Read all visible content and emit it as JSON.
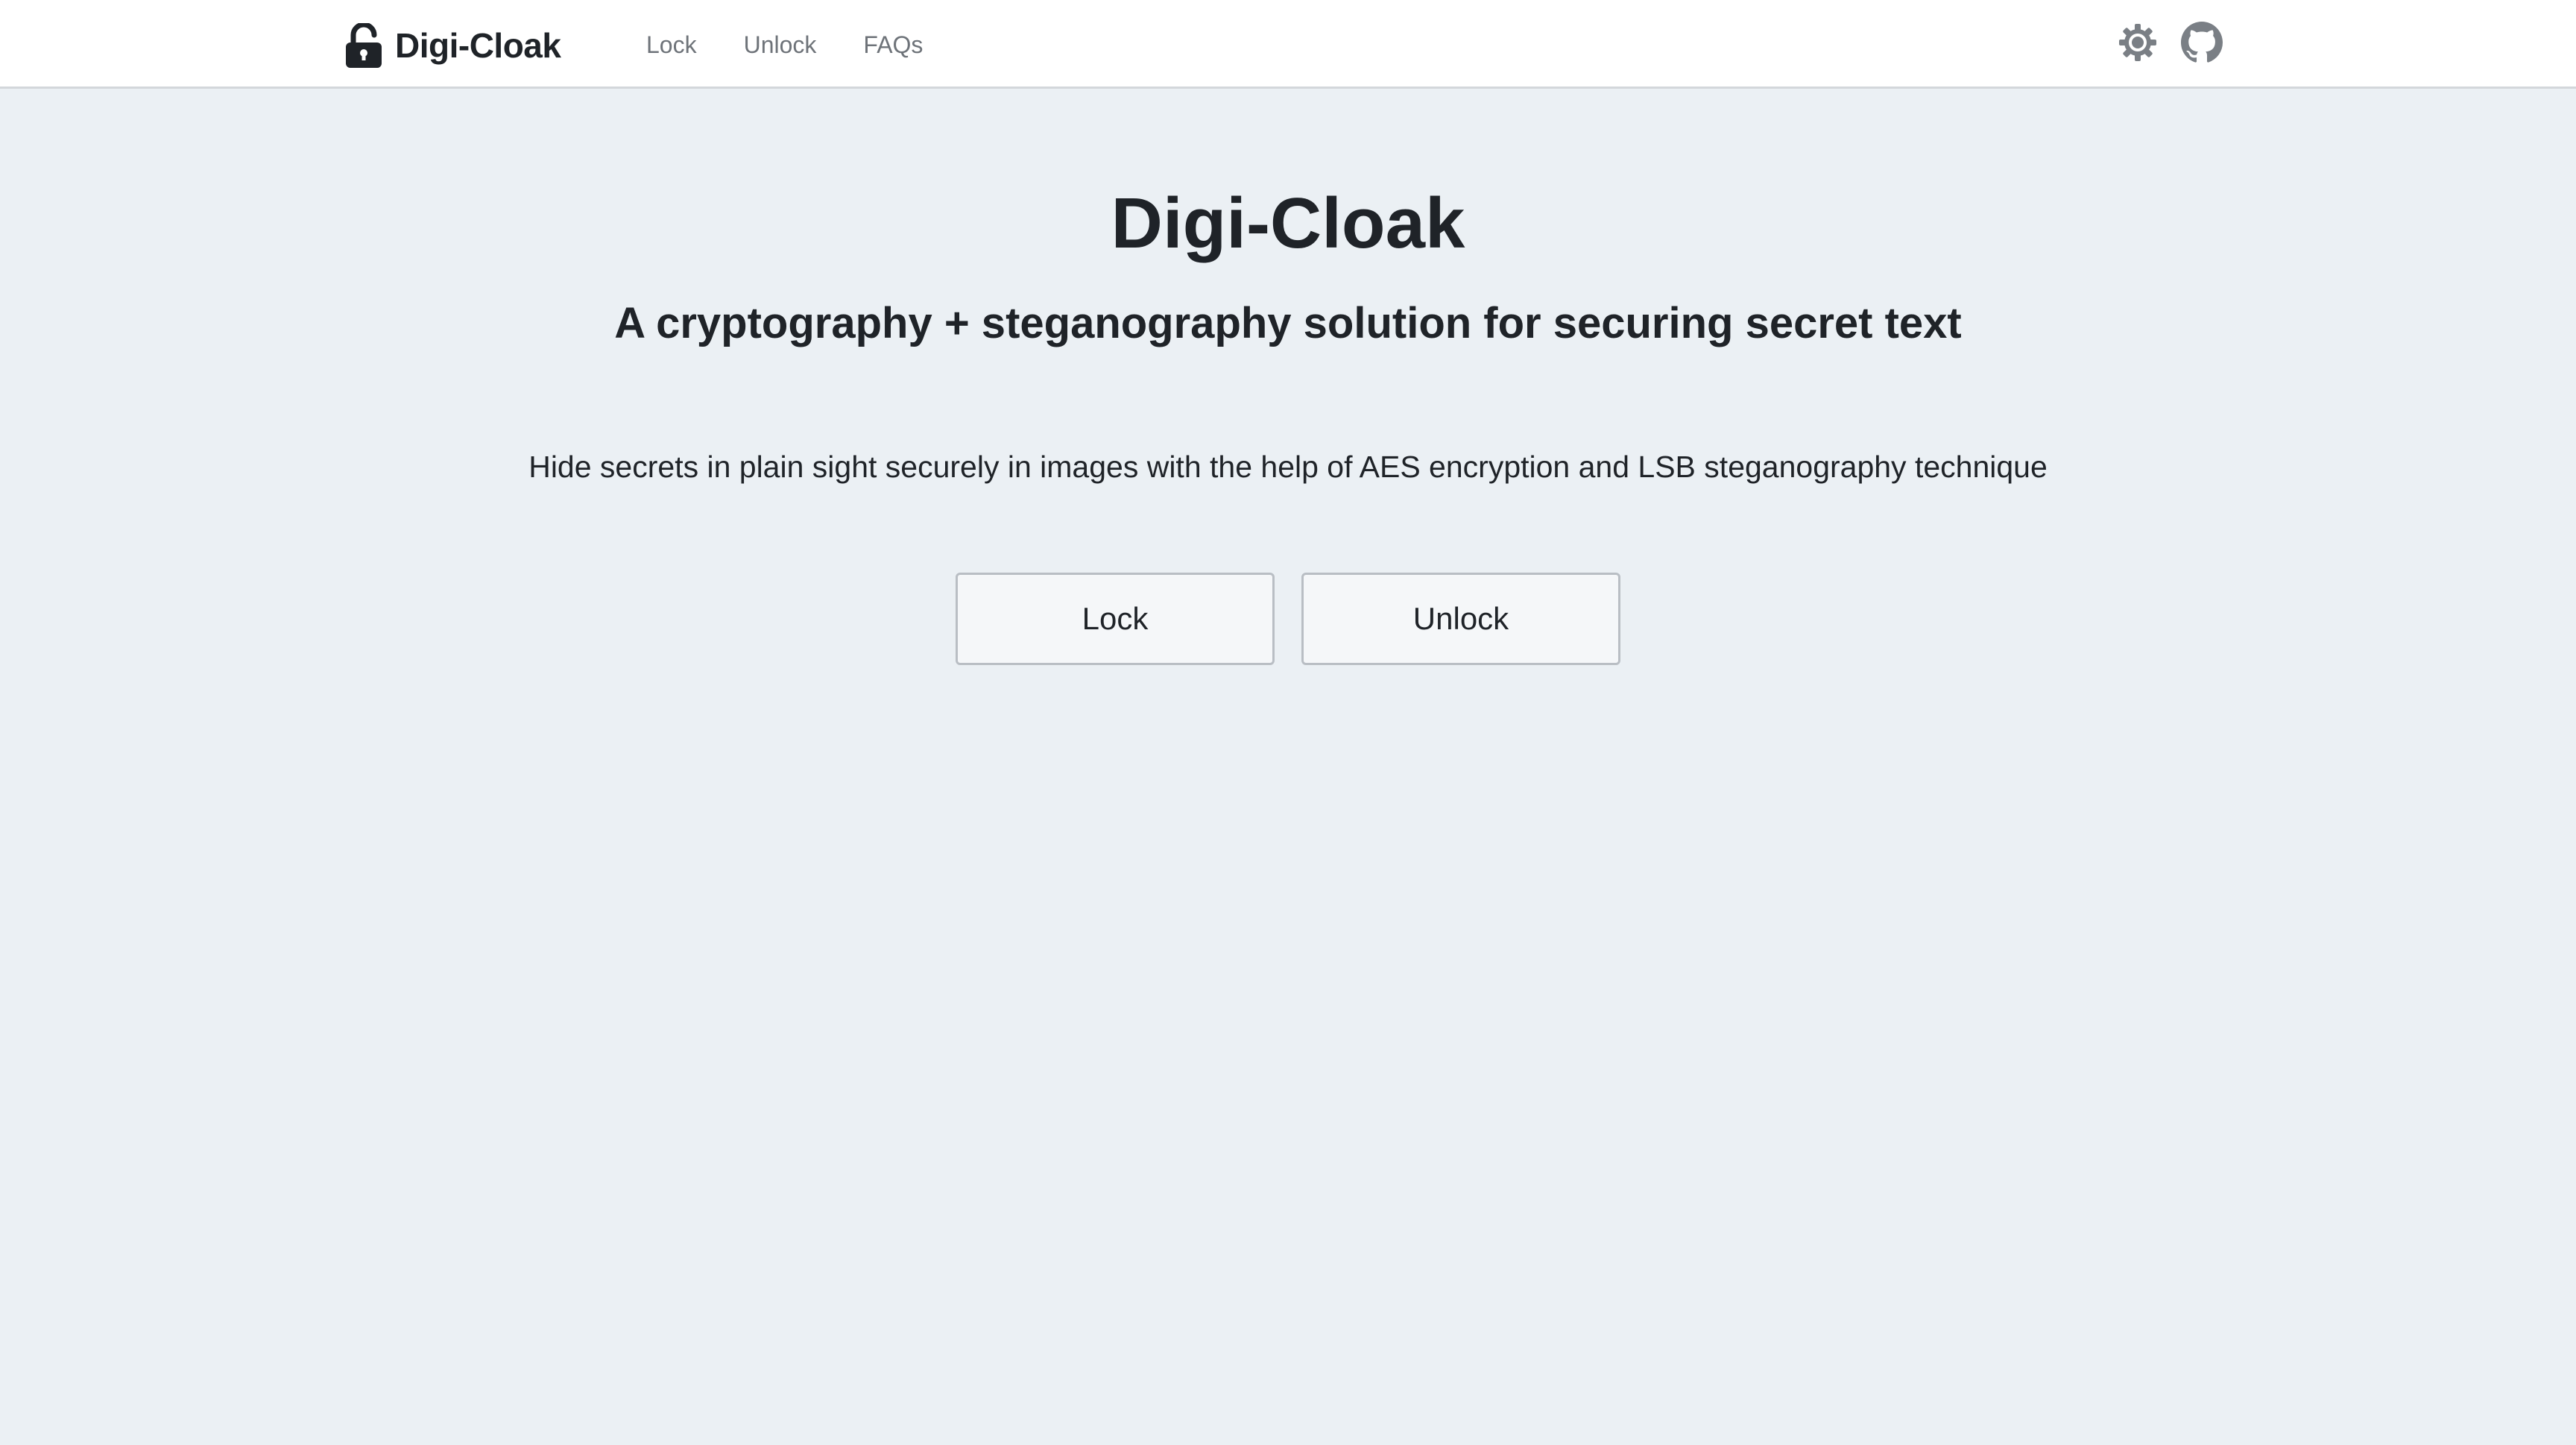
{
  "nav": {
    "brand": "Digi-Cloak",
    "brand_icon": "lock-open-icon",
    "links": [
      {
        "label": "Lock"
      },
      {
        "label": "Unlock"
      },
      {
        "label": "FAQs"
      }
    ],
    "theme_icon": "sun-icon",
    "github_icon": "github-icon"
  },
  "hero": {
    "title": "Digi-Cloak",
    "subtitle": "A cryptography + steganography solution for securing secret text",
    "description": "Hide secrets in plain sight securely in images with the help of AES encryption and LSB steganography technique",
    "buttons": [
      {
        "label": "Lock"
      },
      {
        "label": "Unlock"
      }
    ]
  },
  "colors": {
    "page_background": "#ebf0f4",
    "navbar_background": "#ffffff",
    "text": "#1f2328",
    "nav_link": "#6e7379",
    "button_background": "#f5f7f9",
    "button_border": "#b9bec4"
  }
}
